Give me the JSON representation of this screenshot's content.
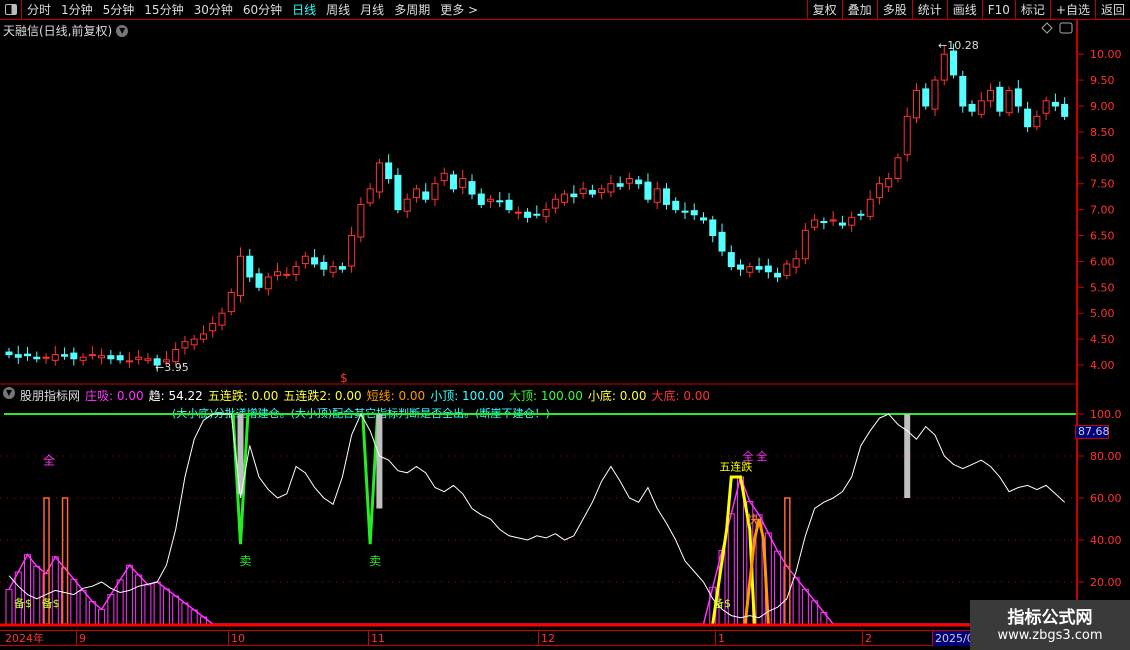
{
  "toolbar": {
    "periods": [
      "分时",
      "1分钟",
      "5分钟",
      "15分钟",
      "30分钟",
      "60分钟",
      "日线",
      "周线",
      "月线",
      "多周期",
      "更多 >"
    ],
    "active": "日线",
    "buttons": [
      "复权",
      "叠加",
      "多股",
      "统计",
      "画线",
      "F10",
      "标记",
      "+自选",
      "返回"
    ]
  },
  "chart": {
    "title": "天融信(日线,前复权)",
    "high_label": "10.28",
    "low_label": "3.95",
    "price_ticks": [
      "10.00",
      "9.50",
      "9.00",
      "8.50",
      "8.00",
      "7.50",
      "7.00",
      "6.50",
      "6.00",
      "5.50",
      "5.00",
      "4.50",
      "4.00"
    ],
    "closes": [
      4.2,
      4.15,
      4.18,
      4.12,
      4.15,
      4.2,
      4.17,
      4.12,
      4.15,
      4.2,
      4.18,
      4.12,
      4.1,
      4.08,
      4.15,
      4.12,
      4.0,
      4.1,
      4.3,
      4.45,
      4.5,
      4.6,
      4.8,
      5.0,
      5.4,
      6.1,
      5.7,
      5.5,
      5.7,
      5.8,
      5.75,
      5.9,
      6.1,
      5.95,
      5.85,
      5.9,
      5.85,
      6.5,
      7.1,
      7.4,
      7.9,
      7.6,
      7.0,
      7.2,
      7.4,
      7.2,
      7.5,
      7.7,
      7.4,
      7.6,
      7.3,
      7.1,
      7.2,
      7.15,
      7.0,
      6.95,
      6.85,
      6.9,
      7.0,
      7.2,
      7.3,
      7.25,
      7.4,
      7.3,
      7.4,
      7.5,
      7.45,
      7.6,
      7.5,
      7.2,
      7.4,
      7.1,
      7.0,
      6.95,
      6.9,
      6.8,
      6.5,
      6.2,
      5.9,
      5.85,
      5.9,
      5.85,
      5.8,
      5.7,
      5.95,
      6.05,
      6.6,
      6.8,
      6.75,
      6.8,
      6.7,
      6.85,
      6.9,
      7.2,
      7.5,
      7.6,
      8.0,
      8.8,
      9.3,
      9.0,
      9.5,
      10.0,
      9.6,
      9.0,
      8.9,
      9.1,
      9.3,
      8.9,
      9.3,
      9.0,
      8.6,
      8.8,
      9.1,
      9.0,
      8.8
    ]
  },
  "indicator": {
    "name": "股朋指标网",
    "fields": [
      {
        "label": "庄吸:",
        "value": "0.00",
        "color": "#ff33ff"
      },
      {
        "label": "趋:",
        "value": "54.22",
        "color": "#ffffff"
      },
      {
        "label": "五连跌:",
        "value": "0.00",
        "color": "#ffff33"
      },
      {
        "label": "五连跌2:",
        "value": "0.00",
        "color": "#ffff33"
      },
      {
        "label": "短线:",
        "value": "0.00",
        "color": "#ff9900"
      },
      {
        "label": "小顶:",
        "value": "100.00",
        "color": "#33ffff"
      },
      {
        "label": "大顶:",
        "value": "100.00",
        "color": "#33ff33"
      },
      {
        "label": "小底:",
        "value": "0.00",
        "color": "#ffff33"
      },
      {
        "label": "大底:",
        "value": "0.00",
        "color": "#ff3333"
      }
    ],
    "note": "(大小底)分批递增建仓。(大小顶)配合其它指标判断是否全出。(断崖不建仓！)",
    "ticks": [
      "100.0",
      "80.00",
      "60.00",
      "40.00",
      "20.00"
    ],
    "current": "87.68",
    "trend": [
      23,
      18,
      14,
      12,
      14,
      16,
      15,
      14,
      17,
      18,
      20,
      17,
      15,
      16,
      18,
      19,
      20,
      28,
      45,
      70,
      88,
      97,
      100,
      100,
      100,
      60,
      85,
      70,
      64,
      60,
      62,
      75,
      72,
      65,
      60,
      57,
      70,
      90,
      100,
      92,
      80,
      78,
      73,
      72,
      75,
      72,
      65,
      63,
      66,
      62,
      55,
      52,
      50,
      45,
      42,
      41,
      40,
      42,
      41,
      43,
      40,
      42,
      50,
      58,
      68,
      75,
      68,
      60,
      58,
      65,
      55,
      48,
      40,
      30,
      25,
      20,
      12,
      7,
      4,
      3,
      4,
      3,
      6,
      8,
      12,
      25,
      42,
      55,
      58,
      60,
      63,
      70,
      85,
      92,
      98,
      100,
      95,
      92,
      88,
      94,
      90,
      80,
      76,
      74,
      76,
      78,
      75,
      70,
      63,
      65,
      66,
      64,
      66,
      62,
      58
    ],
    "zhuangxi_peaks": [
      {
        "i": 2,
        "v": 33
      },
      {
        "i": 5,
        "v": 32
      },
      {
        "i": 13,
        "v": 28
      },
      {
        "i": 16,
        "v": 20
      },
      {
        "i": 79,
        "v": 70
      },
      {
        "i": 81,
        "v": 52
      },
      {
        "i": 83,
        "v": 33
      }
    ],
    "short_bars": [
      {
        "i": 4,
        "v": 60
      },
      {
        "i": 6,
        "v": 60
      },
      {
        "i": 84,
        "v": 60
      }
    ],
    "top_bars": [
      {
        "i": 25,
        "v": 62
      },
      {
        "i": 40,
        "v": 55
      },
      {
        "i": 97,
        "v": 60
      }
    ],
    "sell_v": [
      {
        "i": 25,
        "v": 38
      },
      {
        "i": 39,
        "v": 38
      }
    ],
    "labels": {
      "all": "全",
      "sell": "卖",
      "prep": "备$",
      "five": "五连跌",
      "fast": "快"
    }
  },
  "dates": {
    "labels": [
      "2024年",
      "9",
      "10",
      "11",
      "12",
      "1",
      "2"
    ],
    "current": "2025/0"
  },
  "watermark": {
    "name": "指标公式网",
    "url": "www.zbgs3.com"
  }
}
